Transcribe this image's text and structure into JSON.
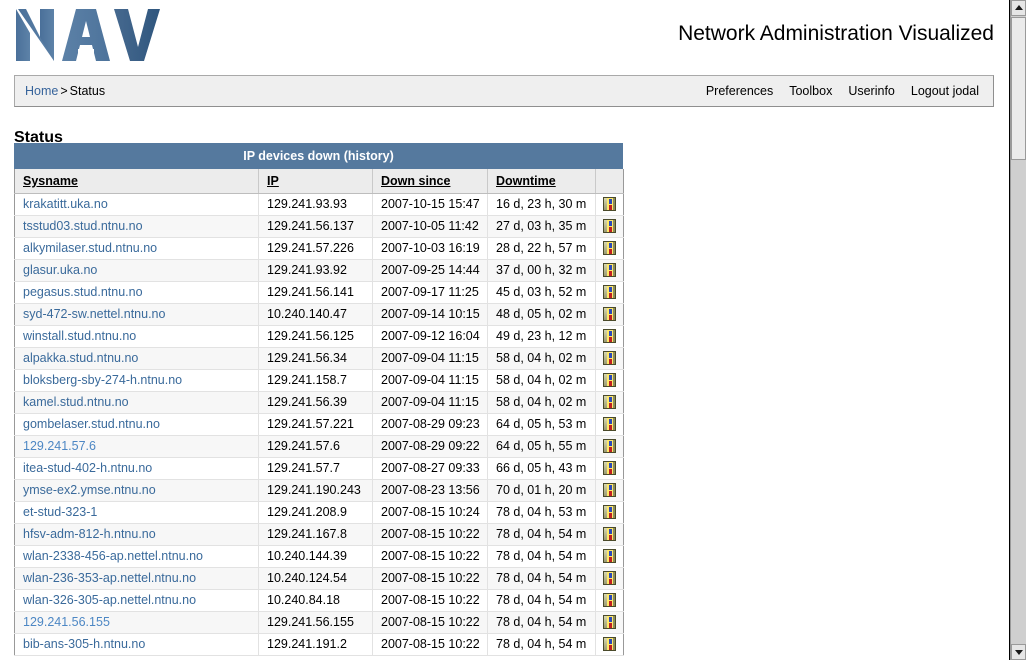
{
  "masthead": {
    "logo_text": "NAV",
    "tagline": "Network Administration Visualized"
  },
  "navbar": {
    "breadcrumb": {
      "home_label": "Home",
      "separator": ">",
      "current_label": "Status"
    },
    "links": [
      {
        "label": "Preferences"
      },
      {
        "label": "Toolbox"
      },
      {
        "label": "Userinfo"
      },
      {
        "label": "Logout jodal"
      }
    ]
  },
  "page": {
    "title": "Status"
  },
  "table": {
    "caption": "IP devices down (history)",
    "columns": [
      {
        "label": "Sysname"
      },
      {
        "label": "IP"
      },
      {
        "label": "Down since"
      },
      {
        "label": "Downtime"
      },
      {
        "label": ""
      }
    ],
    "rows": [
      {
        "sysname": "krakatitt.uka.no",
        "ip": "129.241.93.93",
        "down_since": "2007-10-15 15:47",
        "downtime": "16 d, 23 h, 30 m",
        "icon": "device-info-icon",
        "highlight": false
      },
      {
        "sysname": "tsstud03.stud.ntnu.no",
        "ip": "129.241.56.137",
        "down_since": "2007-10-05 11:42",
        "downtime": "27 d, 03 h, 35 m",
        "icon": "device-info-icon",
        "highlight": false
      },
      {
        "sysname": "alkymilaser.stud.ntnu.no",
        "ip": "129.241.57.226",
        "down_since": "2007-10-03 16:19",
        "downtime": "28 d, 22 h, 57 m",
        "icon": "device-info-icon",
        "highlight": false
      },
      {
        "sysname": "glasur.uka.no",
        "ip": "129.241.93.92",
        "down_since": "2007-09-25 14:44",
        "downtime": "37 d, 00 h, 32 m",
        "icon": "device-info-icon",
        "highlight": false
      },
      {
        "sysname": "pegasus.stud.ntnu.no",
        "ip": "129.241.56.141",
        "down_since": "2007-09-17 11:25",
        "downtime": "45 d, 03 h, 52 m",
        "icon": "device-info-icon",
        "highlight": false
      },
      {
        "sysname": "syd-472-sw.nettel.ntnu.no",
        "ip": "10.240.140.47",
        "down_since": "2007-09-14 10:15",
        "downtime": "48 d, 05 h, 02 m",
        "icon": "device-info-icon",
        "highlight": false
      },
      {
        "sysname": "winstall.stud.ntnu.no",
        "ip": "129.241.56.125",
        "down_since": "2007-09-12 16:04",
        "downtime": "49 d, 23 h, 12 m",
        "icon": "device-info-icon",
        "highlight": false
      },
      {
        "sysname": "alpakka.stud.ntnu.no",
        "ip": "129.241.56.34",
        "down_since": "2007-09-04 11:15",
        "downtime": "58 d, 04 h, 02 m",
        "icon": "device-info-icon",
        "highlight": false
      },
      {
        "sysname": "bloksberg-sby-274-h.ntnu.no",
        "ip": "129.241.158.7",
        "down_since": "2007-09-04 11:15",
        "downtime": "58 d, 04 h, 02 m",
        "icon": "device-info-icon",
        "highlight": false
      },
      {
        "sysname": "kamel.stud.ntnu.no",
        "ip": "129.241.56.39",
        "down_since": "2007-09-04 11:15",
        "downtime": "58 d, 04 h, 02 m",
        "icon": "device-info-icon",
        "highlight": false
      },
      {
        "sysname": "gombelaser.stud.ntnu.no",
        "ip": "129.241.57.221",
        "down_since": "2007-08-29 09:23",
        "downtime": "64 d, 05 h, 53 m",
        "icon": "device-info-icon",
        "highlight": false
      },
      {
        "sysname": "129.241.57.6",
        "ip": "129.241.57.6",
        "down_since": "2007-08-29 09:22",
        "downtime": "64 d, 05 h, 55 m",
        "icon": "device-info-icon",
        "highlight": true
      },
      {
        "sysname": "itea-stud-402-h.ntnu.no",
        "ip": "129.241.57.7",
        "down_since": "2007-08-27 09:33",
        "downtime": "66 d, 05 h, 43 m",
        "icon": "device-info-icon",
        "highlight": false
      },
      {
        "sysname": "ymse-ex2.ymse.ntnu.no",
        "ip": "129.241.190.243",
        "down_since": "2007-08-23 13:56",
        "downtime": "70 d, 01 h, 20 m",
        "icon": "device-info-icon",
        "highlight": false
      },
      {
        "sysname": "et-stud-323-1",
        "ip": "129.241.208.9",
        "down_since": "2007-08-15 10:24",
        "downtime": "78 d, 04 h, 53 m",
        "icon": "device-info-icon",
        "highlight": false
      },
      {
        "sysname": "hfsv-adm-812-h.ntnu.no",
        "ip": "129.241.167.8",
        "down_since": "2007-08-15 10:22",
        "downtime": "78 d, 04 h, 54 m",
        "icon": "device-info-icon",
        "highlight": false
      },
      {
        "sysname": "wlan-2338-456-ap.nettel.ntnu.no",
        "ip": "10.240.144.39",
        "down_since": "2007-08-15 10:22",
        "downtime": "78 d, 04 h, 54 m",
        "icon": "device-info-icon",
        "highlight": false
      },
      {
        "sysname": "wlan-236-353-ap.nettel.ntnu.no",
        "ip": "10.240.124.54",
        "down_since": "2007-08-15 10:22",
        "downtime": "78 d, 04 h, 54 m",
        "icon": "device-info-icon",
        "highlight": false
      },
      {
        "sysname": "wlan-326-305-ap.nettel.ntnu.no",
        "ip": "10.240.84.18",
        "down_since": "2007-08-15 10:22",
        "downtime": "78 d, 04 h, 54 m",
        "icon": "device-info-icon",
        "highlight": false
      },
      {
        "sysname": "129.241.56.155",
        "ip": "129.241.56.155",
        "down_since": "2007-08-15 10:22",
        "downtime": "78 d, 04 h, 54 m",
        "icon": "device-info-icon",
        "highlight": true
      },
      {
        "sysname": "bib-ans-305-h.ntnu.no",
        "ip": "129.241.191.2",
        "down_since": "2007-08-15 10:22",
        "downtime": "78 d, 04 h, 54 m",
        "icon": "device-info-icon",
        "highlight": false
      }
    ]
  },
  "scrollbar": {
    "up_icon": "scroll-up-arrow-icon",
    "down_icon": "scroll-down-arrow-icon"
  },
  "colors": {
    "brand_blue": "#55799e",
    "link_blue": "#3a6a9b",
    "link_blue_bright": "#4d87c4",
    "navbar_bg": "#efefef",
    "header_row_bg": "#ececec"
  }
}
